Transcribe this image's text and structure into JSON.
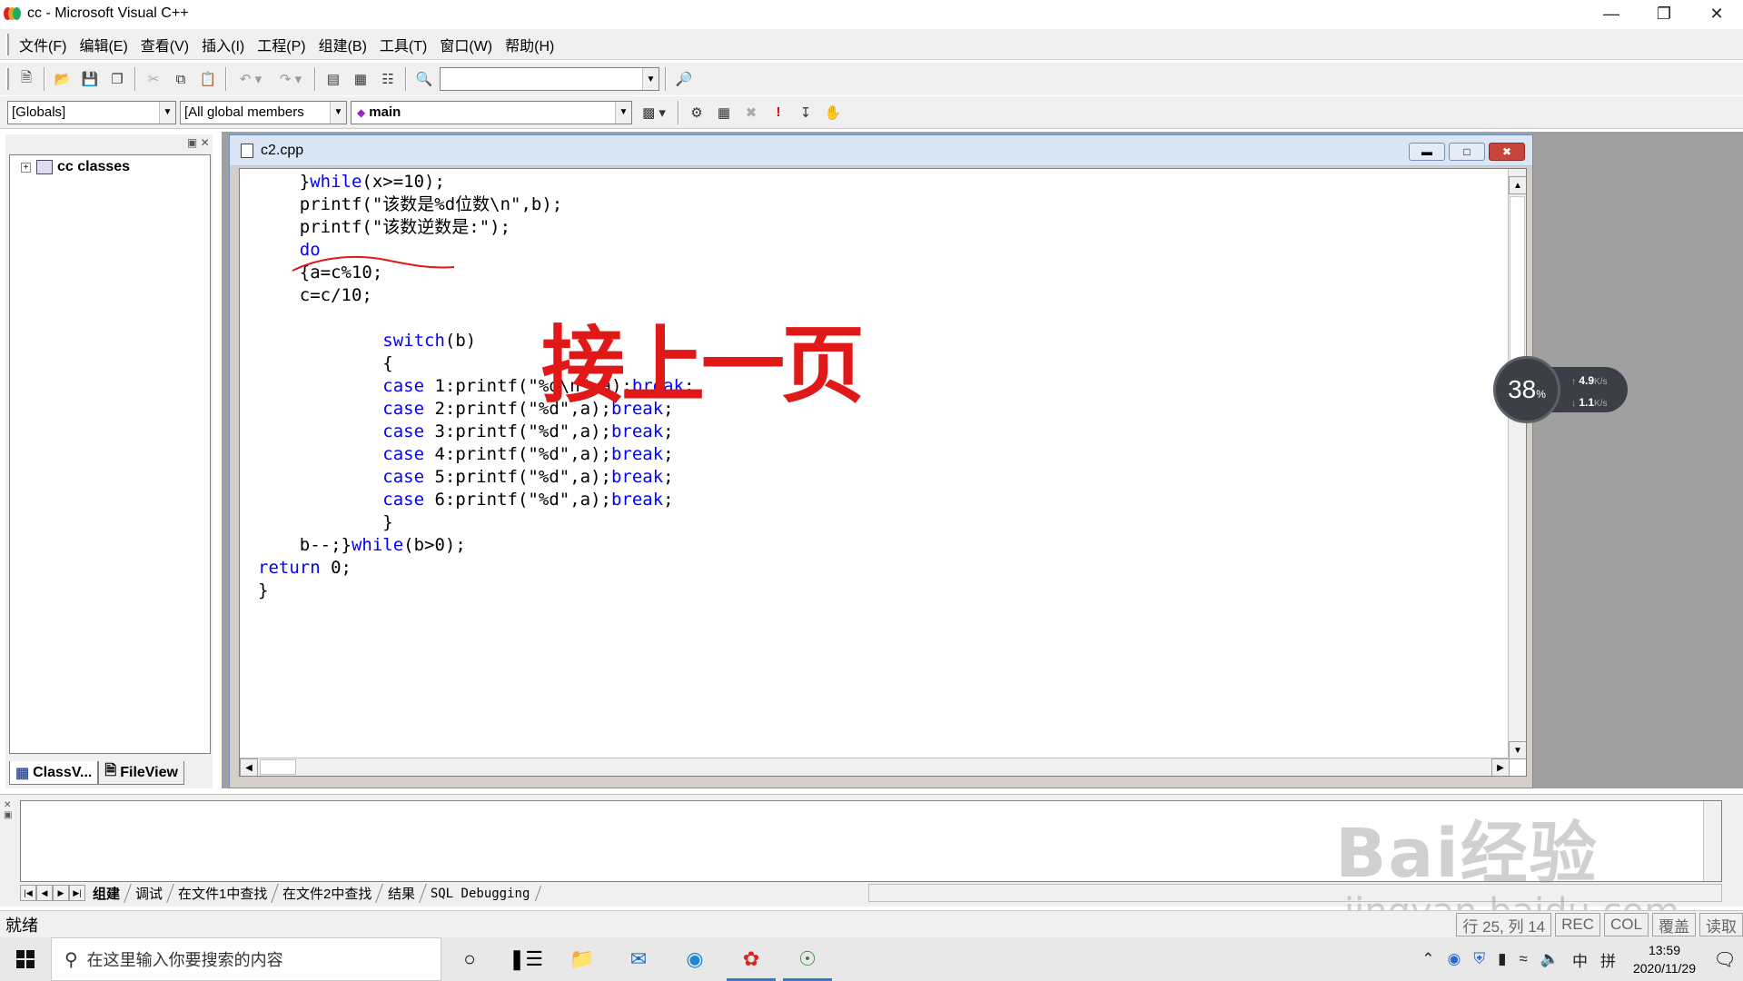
{
  "window": {
    "title": "cc - Microsoft Visual C++"
  },
  "menu": [
    "文件(F)",
    "编辑(E)",
    "查看(V)",
    "插入(I)",
    "工程(P)",
    "组建(B)",
    "工具(T)",
    "窗口(W)",
    "帮助(H)"
  ],
  "wizard_bar": {
    "class_combo": "[Globals]",
    "filter_combo": "[All global members",
    "member_combo": "main"
  },
  "left_pane": {
    "tree_root": "cc classes",
    "tabs": [
      "ClassV...",
      "FileView"
    ]
  },
  "document": {
    "title": "c2.cpp"
  },
  "code_lines": [
    "    }while(x>=10);",
    "    printf(\"该数是%d位数\\n\",b);",
    "    printf(\"该数逆数是:\");",
    "    do",
    "    {a=c%10;",
    "    c=c/10;",
    "",
    "            switch(b)",
    "            {",
    "            case 1:printf(\"%d\\n\",a);break;",
    "            case 2:printf(\"%d\",a);break;",
    "            case 3:printf(\"%d\",a);break;",
    "            case 4:printf(\"%d\",a);break;",
    "            case 5:printf(\"%d\",a);break;",
    "            case 6:printf(\"%d\",a);break;",
    "            }",
    "    b--;}while(b>0);",
    "return 0;",
    "}"
  ],
  "keywords": [
    "while",
    "do",
    "switch",
    "case",
    "break",
    "return"
  ],
  "annotation": "接上一页",
  "net_speed": {
    "percent": "38",
    "percent_unit": "%",
    "upload": "4.9",
    "download": "1.1",
    "unit": "K/s"
  },
  "output_tabs": [
    "组建",
    "调试",
    "在文件1中查找",
    "在文件2中查找",
    "结果",
    "SQL Debugging"
  ],
  "status": {
    "ready": "就绪",
    "cells": [
      "行 25, 列 14",
      "REC",
      "COL",
      "覆盖",
      "读取"
    ]
  },
  "taskbar": {
    "search_placeholder": "在这里输入你要搜索的内容",
    "tray_ime": "中",
    "tray_ime2": "拼",
    "time": "13:59",
    "date": "2020/11/29"
  },
  "watermark": {
    "line1": "Bai经验",
    "line2": "jingyan.baidu.com"
  },
  "colors": {
    "keyword": "#0000ff",
    "annotation": "#e01818"
  }
}
